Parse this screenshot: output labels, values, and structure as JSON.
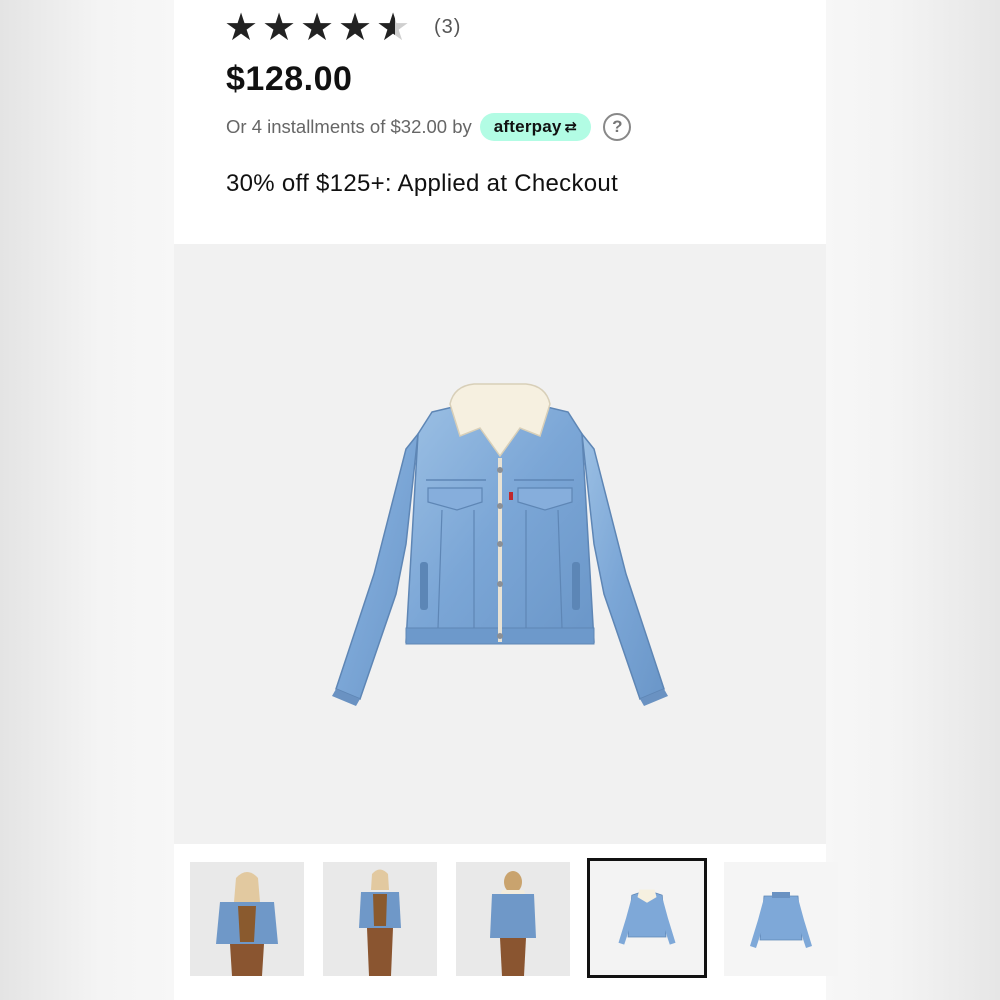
{
  "rating": {
    "score": 4.5,
    "count_label": "(3)"
  },
  "price": "$128.00",
  "installments": {
    "text": "Or 4 installments of $32.00 by",
    "provider": "afterpay",
    "provider_color": "#b2fce4",
    "help_icon": "question-circle-icon",
    "help_glyph": "?"
  },
  "promo": "30% off $125+: Applied at Checkout",
  "gallery": {
    "selected_index": 3,
    "thumbnails": [
      {
        "view": "model-front"
      },
      {
        "view": "model-full"
      },
      {
        "view": "model-back"
      },
      {
        "view": "product-front"
      },
      {
        "view": "product-back"
      }
    ]
  }
}
